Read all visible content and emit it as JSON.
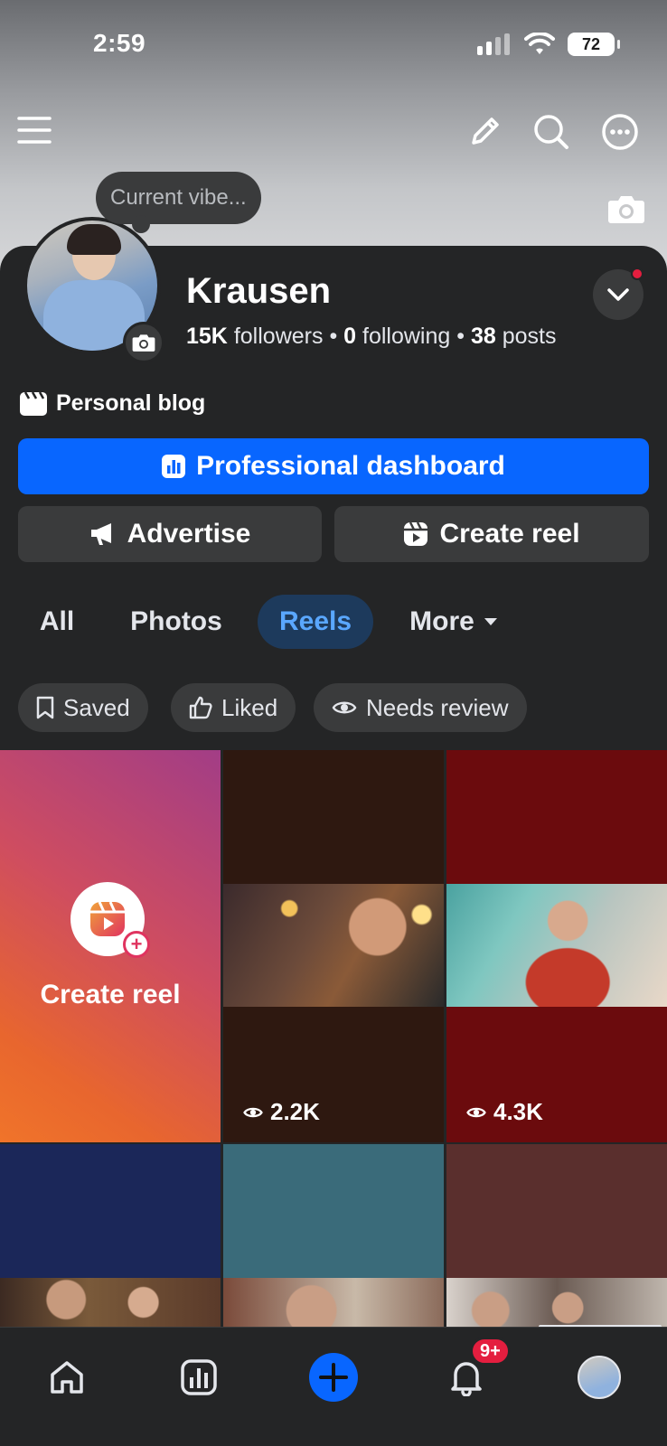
{
  "status_bar": {
    "time": "2:59",
    "battery": "72"
  },
  "cover": {
    "vibe_placeholder": "Current vibe..."
  },
  "profile": {
    "name": "Krausen",
    "followers_count": "15K",
    "followers_label": "followers",
    "following_count": "0",
    "following_label": "following",
    "posts_count": "38",
    "posts_label": "posts",
    "separator": "•",
    "category": "Personal blog"
  },
  "actions": {
    "professional_dashboard": "Professional dashboard",
    "advertise": "Advertise",
    "create_reel": "Create reel"
  },
  "tabs": [
    {
      "label": "All"
    },
    {
      "label": "Photos"
    },
    {
      "label": "Reels",
      "active": true
    },
    {
      "label": "More"
    }
  ],
  "filters": [
    {
      "label": "Saved",
      "icon": "bookmark-icon"
    },
    {
      "label": "Liked",
      "icon": "thumbs-up-icon"
    },
    {
      "label": "Needs review",
      "icon": "eye-icon"
    }
  ],
  "grid": {
    "create_label": "Create reel",
    "reels": [
      {
        "views": "2.2K",
        "bg": "#2e1810"
      },
      {
        "views": "4.3K",
        "bg": "#6b0b0d"
      }
    ],
    "row2_bg": [
      "#1b2759",
      "#3a6b7a",
      "#5a2f2d"
    ]
  },
  "bottom_nav": {
    "notifications_badge": "9+"
  },
  "colors": {
    "accent": "#0866ff",
    "badge": "#e41e3f",
    "panel": "#242526",
    "button": "#3a3b3c"
  }
}
